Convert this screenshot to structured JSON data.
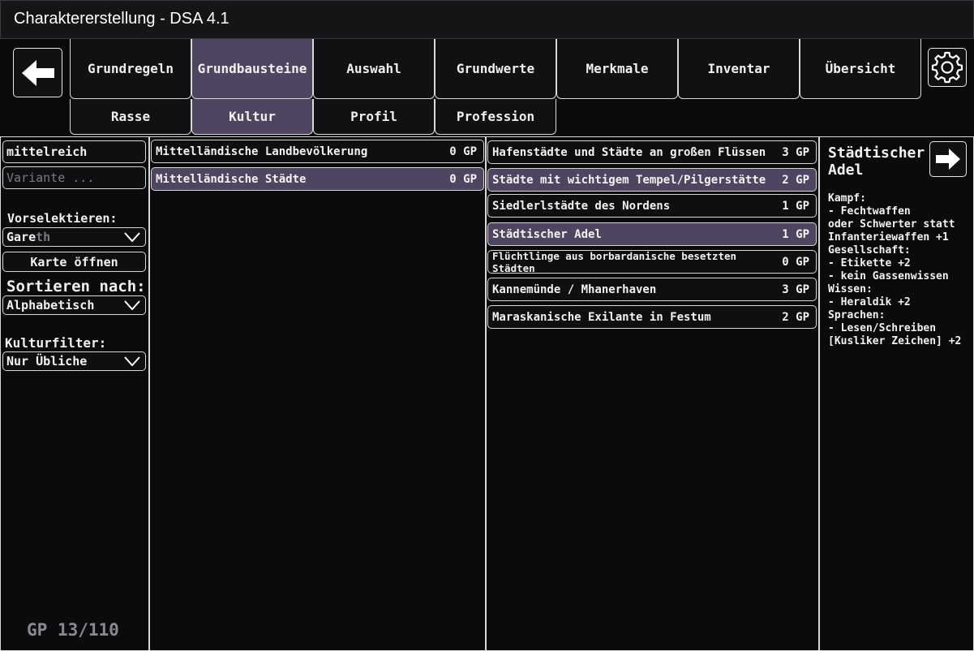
{
  "window": {
    "title": "Charaktererstellung - DSA 4.1"
  },
  "nav": {
    "back_icon": "arrow-left-icon",
    "settings_icon": "gear-icon",
    "main_tabs": [
      {
        "label": "Grundregeln",
        "active": false
      },
      {
        "label": "Grundbausteine",
        "active": true
      },
      {
        "label": "Auswahl",
        "active": false
      },
      {
        "label": "Grundwerte",
        "active": false
      },
      {
        "label": "Merkmale",
        "active": false
      },
      {
        "label": "Inventar",
        "active": false
      },
      {
        "label": "Übersicht",
        "active": false
      }
    ],
    "sub_tabs": [
      {
        "label": "Rasse",
        "active": false
      },
      {
        "label": "Kultur",
        "active": true
      },
      {
        "label": "Profil",
        "active": false
      },
      {
        "label": "Profession",
        "active": false
      }
    ]
  },
  "filters": {
    "search_value": "mittelreich",
    "variant_placeholder": "Variante ...",
    "preselect_label": "Vorselektieren:",
    "preselect_value": "Gare",
    "preselect_hint": "th",
    "map_button": "Karte öffnen",
    "sort_label": "Sortieren nach:",
    "sort_value": "Alphabetisch",
    "culture_filter_label": "Kulturfilter:",
    "culture_filter_value": "Nur Übliche",
    "gp_total": "GP 13/110"
  },
  "cultures": [
    {
      "name": "Mittelländische Landbevölkerung",
      "gp": "0 GP",
      "selected": false
    },
    {
      "name": "Mittelländische Städte",
      "gp": "0 GP",
      "selected": true
    }
  ],
  "variants": [
    {
      "name": "Hafenstädte und Städte an großen Flüssen",
      "gp": "3 GP",
      "selected": false
    },
    {
      "name": "Städte mit wichtigem Tempel/Pilgerstätte",
      "gp": "2 GP",
      "selected": true
    },
    {
      "name": "Siedlerlstädte des Nordens",
      "gp": "1 GP",
      "selected": false
    },
    {
      "name": "Städtischer Adel",
      "gp": "1 GP",
      "selected": true
    },
    {
      "name": "Flüchtlinge aus borbardanische besetzten Städten",
      "gp": "0 GP",
      "selected": false
    },
    {
      "name": "Kannemünde / Mhanerhaven",
      "gp": "3 GP",
      "selected": false
    },
    {
      "name": "Maraskanische Exilante in Festum",
      "gp": "2 GP",
      "selected": false
    }
  ],
  "detail": {
    "title_line1": "Städtischer",
    "title_line2": "Adel",
    "next_icon": "arrow-right-icon",
    "lines": [
      "Kampf:",
      "- Fechtwaffen",
      "oder Schwerter statt",
      "Infanteriewaffen +1",
      "Gesellschaft:",
      "- Etikette +2",
      "- kein Gassenwissen",
      "Wissen:",
      "- Heraldik +2",
      "Sprachen:",
      "- Lesen/Schreiben",
      "[Kusliker Zeichen] +2"
    ]
  },
  "colors": {
    "selected": "#4f4560",
    "border": "#d8d8d8",
    "background": "#0b0b0e"
  }
}
